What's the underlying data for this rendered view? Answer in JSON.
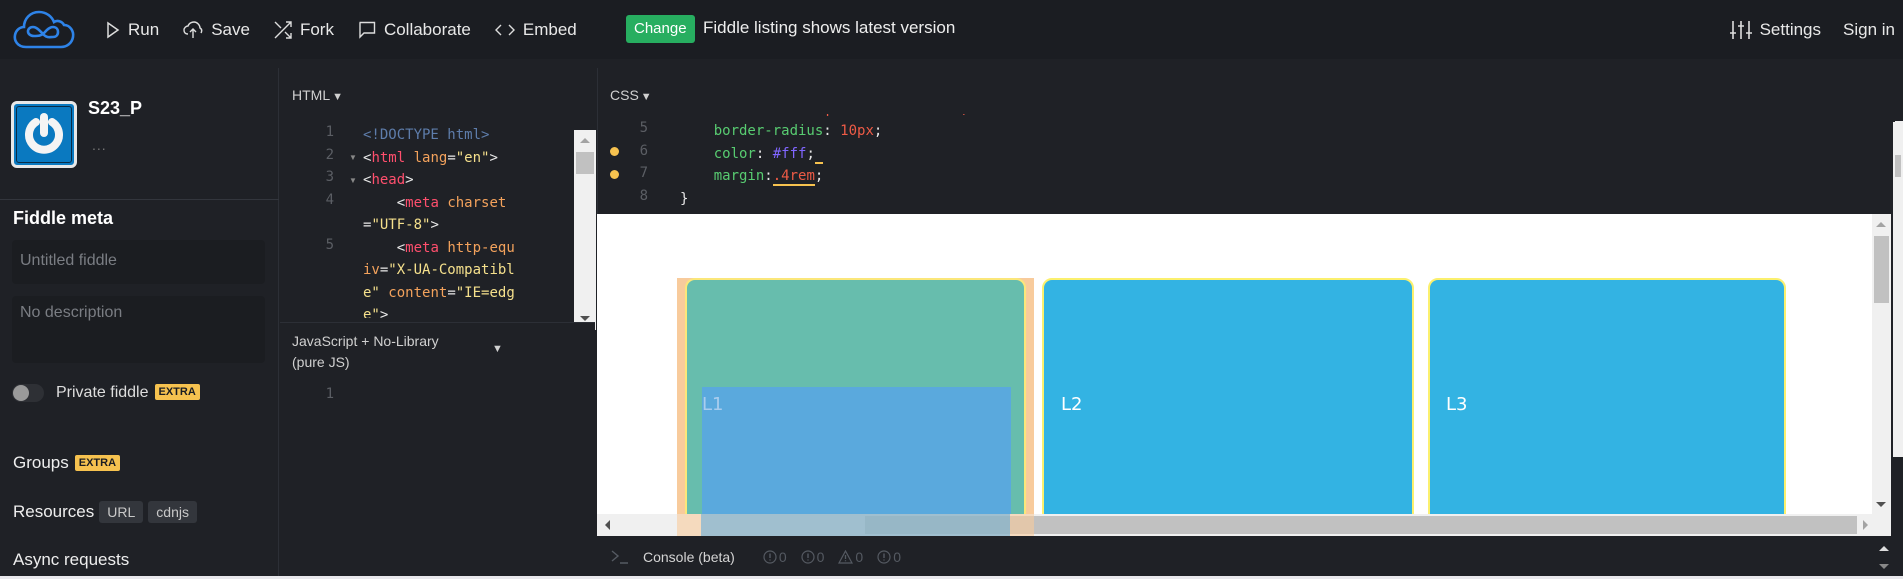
{
  "topbar": {
    "nav": [
      {
        "label": "Run",
        "icon": "play-icon"
      },
      {
        "label": "Save",
        "icon": "upload-cloud-icon"
      },
      {
        "label": "Fork",
        "icon": "fork-icon"
      },
      {
        "label": "Collaborate",
        "icon": "chat-icon"
      },
      {
        "label": "Embed",
        "icon": "code-icon"
      }
    ],
    "change_button": "Change",
    "change_message": "Fiddle listing shows latest version",
    "settings_label": "Settings",
    "signin_label": "Sign in"
  },
  "sidebar": {
    "username": "S23_P",
    "more": "...",
    "meta_title": "Fiddle meta",
    "title_placeholder": "Untitled fiddle",
    "description_placeholder": "No description",
    "private_label": "Private fiddle",
    "private_enabled": false,
    "extra_badge": "EXTRA",
    "groups_label": "Groups",
    "resources_label": "Resources",
    "resources_tags": [
      "URL",
      "cdnjs"
    ],
    "async_label": "Async requests"
  },
  "editors": {
    "html": {
      "label": "HTML",
      "line_numbers": [
        "1",
        "2",
        "3",
        "4",
        "5"
      ]
    },
    "js": {
      "label_line1": "JavaScript + No-Library",
      "label_line2": "(pure JS)",
      "line_numbers": [
        "1"
      ]
    },
    "css": {
      "label": "CSS",
      "line_numbers": [
        "5",
        "6",
        "7",
        "8"
      ],
      "lines": [
        {
          "prop": "border-radius",
          "value": "10px"
        },
        {
          "prop": "color",
          "value": "#fff"
        },
        {
          "prop": "margin",
          "value": ".4rem"
        },
        {
          "close": "}"
        }
      ]
    }
  },
  "result": {
    "boxes": [
      {
        "label": "L1",
        "color": "#67bdad"
      },
      {
        "label": "L2",
        "color": "#33b3e3"
      },
      {
        "label": "L3",
        "color": "#33b3e3"
      }
    ],
    "border_color": "#fbf06e",
    "highlight_color": "#5aa9dd"
  },
  "console": {
    "label": "Console (beta)",
    "counts": [
      "0",
      "0",
      "0",
      "0"
    ]
  },
  "colors": {
    "brand": "#2e83e8",
    "change_green": "#27ae60",
    "extra_badge": "#f6c24f"
  }
}
